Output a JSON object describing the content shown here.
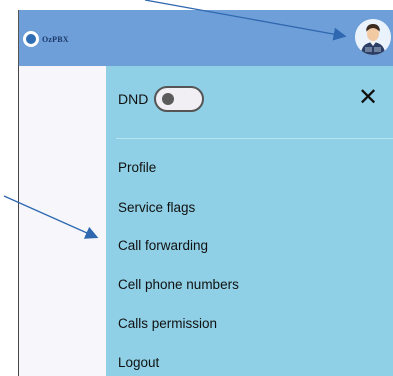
{
  "header": {
    "logo_text": "OzPBX",
    "avatar_icon": "user-avatar-icon"
  },
  "menu": {
    "dnd_label": "DND",
    "dnd_enabled": false,
    "close_icon": "close-icon",
    "items": [
      {
        "label": "Profile"
      },
      {
        "label": "Service flags"
      },
      {
        "label": "Call forwarding"
      },
      {
        "label": "Cell phone numbers"
      },
      {
        "label": "Calls permission"
      },
      {
        "label": "Logout"
      }
    ]
  },
  "colors": {
    "header_bg": "#6f9fd8",
    "menu_bg": "#8fd0e6",
    "arrow": "#2f68b0"
  }
}
